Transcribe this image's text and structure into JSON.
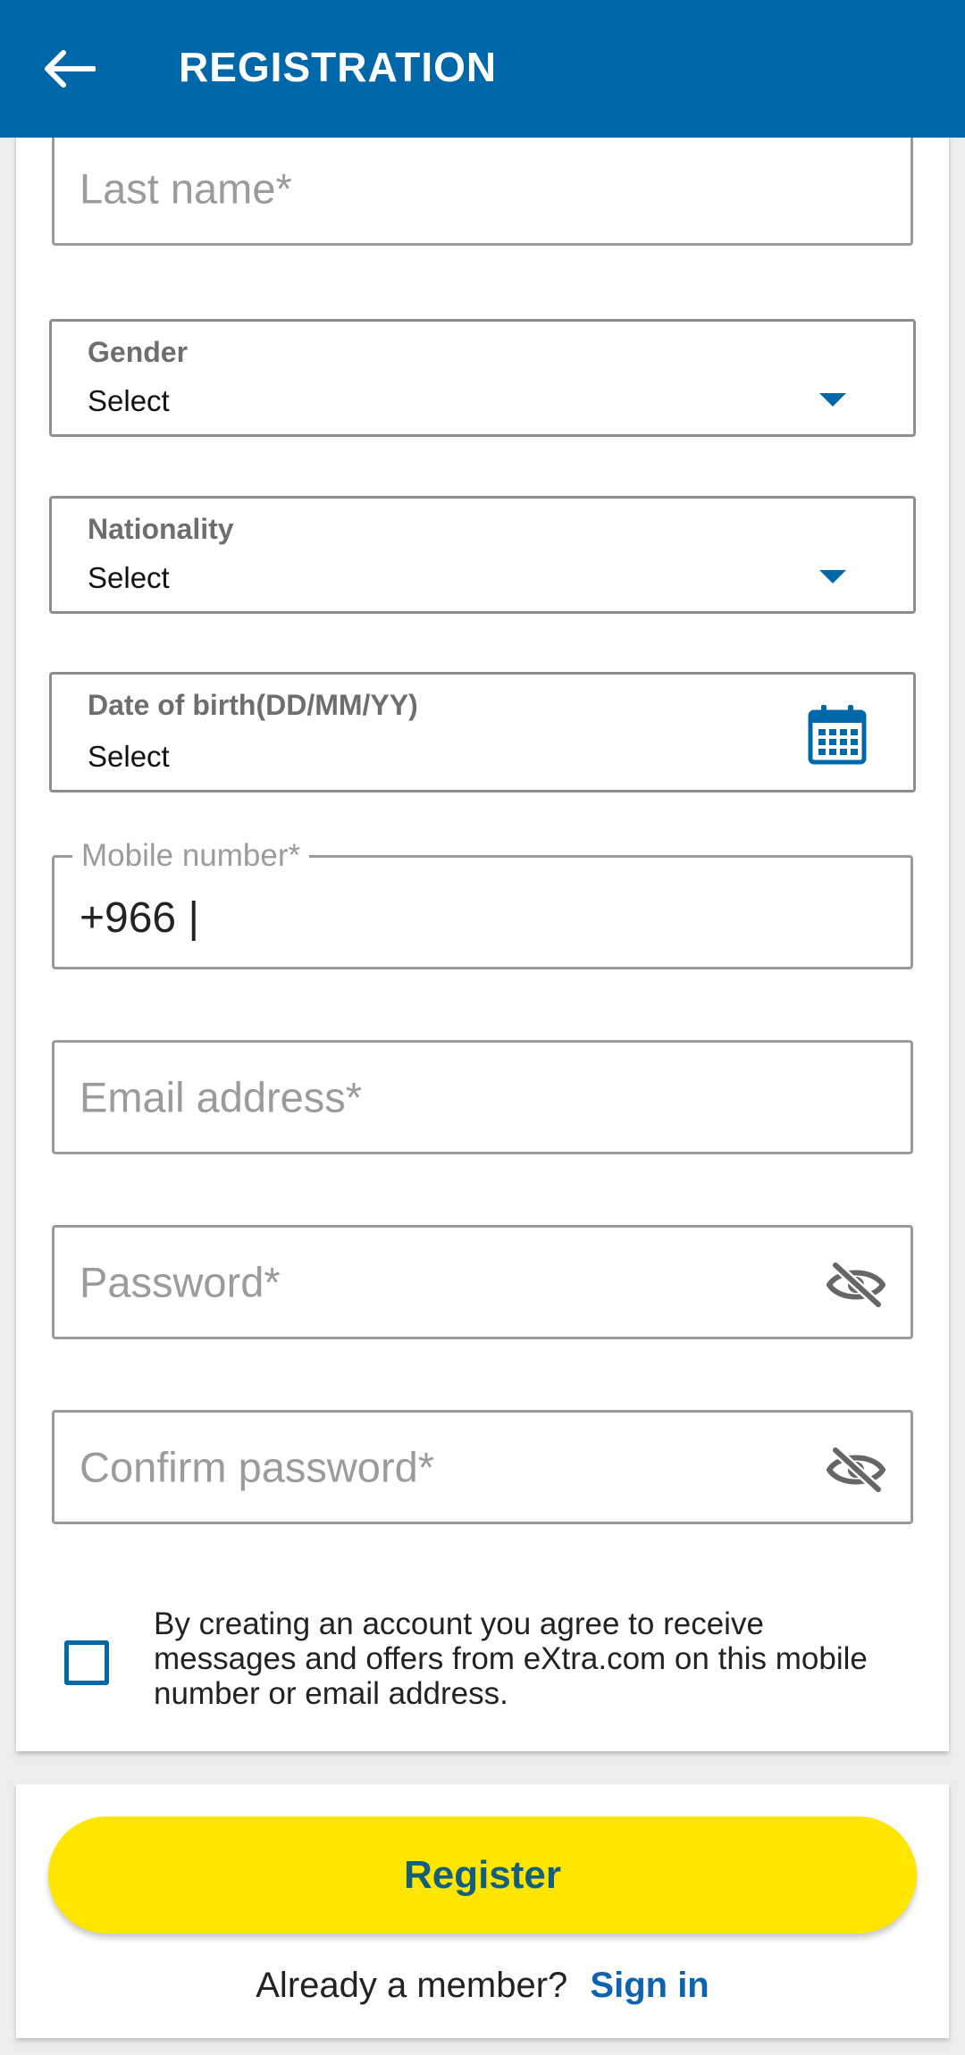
{
  "appbar": {
    "title": "REGISTRATION",
    "back_icon": "arrow-left-icon"
  },
  "fields": {
    "last_name": {
      "placeholder": "Last name*"
    },
    "gender": {
      "label": "Gender",
      "value": "Select"
    },
    "nationality": {
      "label": "Nationality",
      "value": "Select"
    },
    "dob": {
      "label": "Date of birth(DD/MM/YY)",
      "value": "Select",
      "icon": "calendar-icon"
    },
    "mobile": {
      "label": "Mobile number*",
      "value": "+966 |"
    },
    "email": {
      "placeholder": "Email address*"
    },
    "password": {
      "placeholder": "Password*",
      "icon": "eye-off-icon"
    },
    "confirm_password": {
      "placeholder": "Confirm password*",
      "icon": "eye-off-icon"
    }
  },
  "consent": {
    "checked": false,
    "text": "By creating an account you agree to receive messages and offers from eXtra.com on this mobile number or email address."
  },
  "actions": {
    "register_label": "Register",
    "already_member": "Already a member?",
    "sign_in": "Sign in"
  },
  "colors": {
    "brand_blue": "#0067a9",
    "accent_yellow": "#ffe600"
  }
}
